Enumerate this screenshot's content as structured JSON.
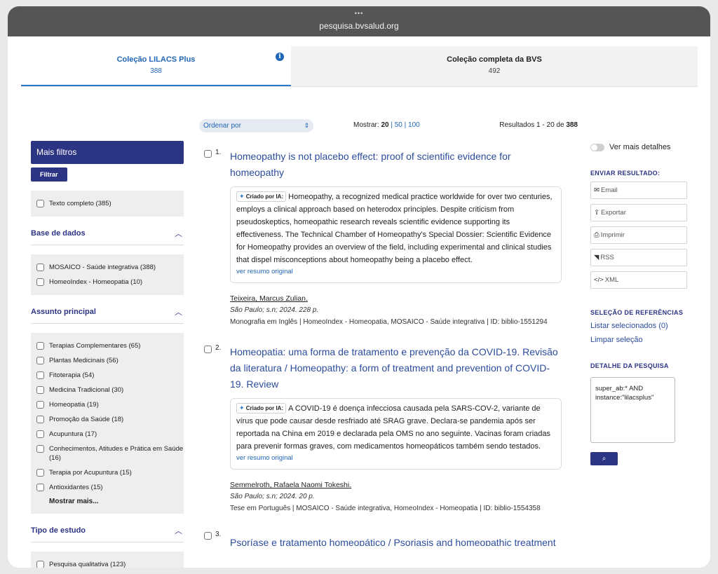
{
  "browser": {
    "dots": "•••",
    "url": "pesquisa.bvsalud.org"
  },
  "tabs": [
    {
      "title": "Coleção LILACS Plus",
      "count": "388",
      "info_icon": "i"
    },
    {
      "title": "Coleção completa da BVS",
      "count": "492"
    }
  ],
  "toolbar": {
    "sort_label": "Ordenar por",
    "show_label": "Mostrar:",
    "show_current": "20",
    "show_sep1": "|",
    "show_opt1": "50",
    "show_sep2": "|",
    "show_opt2": "100",
    "results_prefix": "Resultados 1 - 20 de",
    "results_total": "388"
  },
  "sidebar": {
    "mais_filtros": "Mais filtros",
    "filtrar": "Filtrar",
    "texto_completo": "Texto completo (385)",
    "base_title": "Base de dados",
    "base_items": [
      "MOSAICO - Saúde integrativa (388)",
      "HomeoIndex - Homeopatia (10)"
    ],
    "assunto_title": "Assunto principal",
    "assunto_items": [
      "Terapias Complementares (65)",
      "Plantas Medicinais (56)",
      "Fitoterapia (54)",
      "Medicina Tradicional (30)",
      "Homeopatia (19)",
      "Promoção da Saúde (18)",
      "Acupuntura (17)",
      "Conhecimentos, Atitudes e Prática em Saúde (16)",
      "Terapia por Acupuntura (15)",
      "Antioxidantes (15)"
    ],
    "mostrar_mais": "Mostrar mais...",
    "tipo_title": "Tipo de estudo",
    "tipo_items": [
      "Pesquisa qualitativa (123)"
    ]
  },
  "results": [
    {
      "num": "1.",
      "title": "Homeopathy is not placebo effect: proof of scientific evidence for homeopathy",
      "ai_label": "Criado por IA:",
      "summary": "Homeopathy, a recognized medical practice worldwide for over two centuries, employs a clinical approach based on heterodox principles. Despite criticism from pseudoskeptics, homeopathic research reveals scientific evidence supporting its effectiveness. The Technical Chamber of Homeopathy's Special Dossier: Scientific Evidence for Homeopathy provides an overview of the field, including experimental and clinical studies that dispel misconceptions about homeopathy being a placebo effect.",
      "ver_resumo": "ver resumo original",
      "author": "Teixeira, Marcus Zulian",
      "author_suffix": ".",
      "pub": "São Paulo; s.n; 2024. 228 p.",
      "meta": "Monografia em Inglês | HomeoIndex - Homeopatia, MOSAICO - Saúde integrativa | ID: biblio-1551294"
    },
    {
      "num": "2.",
      "title": "Homeopatia: uma forma de tratamento e prevenção da COVID-19. Revisão da literatura / Homeopathy: a form of treatment and prevention of COVID-19. Review",
      "ai_label": "Criado por IA:",
      "summary": "A COVID-19 é doença infecciosa causada pela SARS-COV-2, variante de vírus que pode causar desde resfriado até SRAG grave. Declara-se pandemia após ser reportada na China em 2019 e declarada pela OMS no ano seguinte. Vacinas foram criadas para prevenir formas graves, com medicamentos homeopáticos também sendo testados.",
      "ver_resumo": "ver resumo original",
      "author": "Semmelroth, Rafaela Naomi Tokeshi",
      "author_suffix": ".",
      "pub": "São Paulo; s.n; 2024. 20 p.",
      "meta": "Tese em Português | MOSAICO - Saúde integrativa, HomeoIndex - Homeopatia | ID: biblio-1554358"
    },
    {
      "num": "3.",
      "title": "Psoríase e tratamento homeopático / Psoriasis and homeopathic treatment"
    }
  ],
  "rightcol": {
    "toggle_label": "Ver mais detalhes",
    "enviar_title": "ENVIAR RESULTADO:",
    "share": [
      {
        "icon": "✉",
        "label": "Email"
      },
      {
        "icon": "⇪",
        "label": "Exportar"
      },
      {
        "icon": "⎙",
        "label": "Imprimir"
      },
      {
        "icon": "◥",
        "label": "RSS"
      },
      {
        "icon": "</>",
        "label": "XML"
      }
    ],
    "selecao_title": "SELEÇÃO DE REFERÊNCIAS",
    "listar": "Listar selecionados (0)",
    "limpar": "Limpar seleção",
    "detalhe_title": "DETALHE DA PESQUISA",
    "query": "super_ab:* AND instance:\"lilacsplus\"",
    "search_icon": "⌕"
  }
}
